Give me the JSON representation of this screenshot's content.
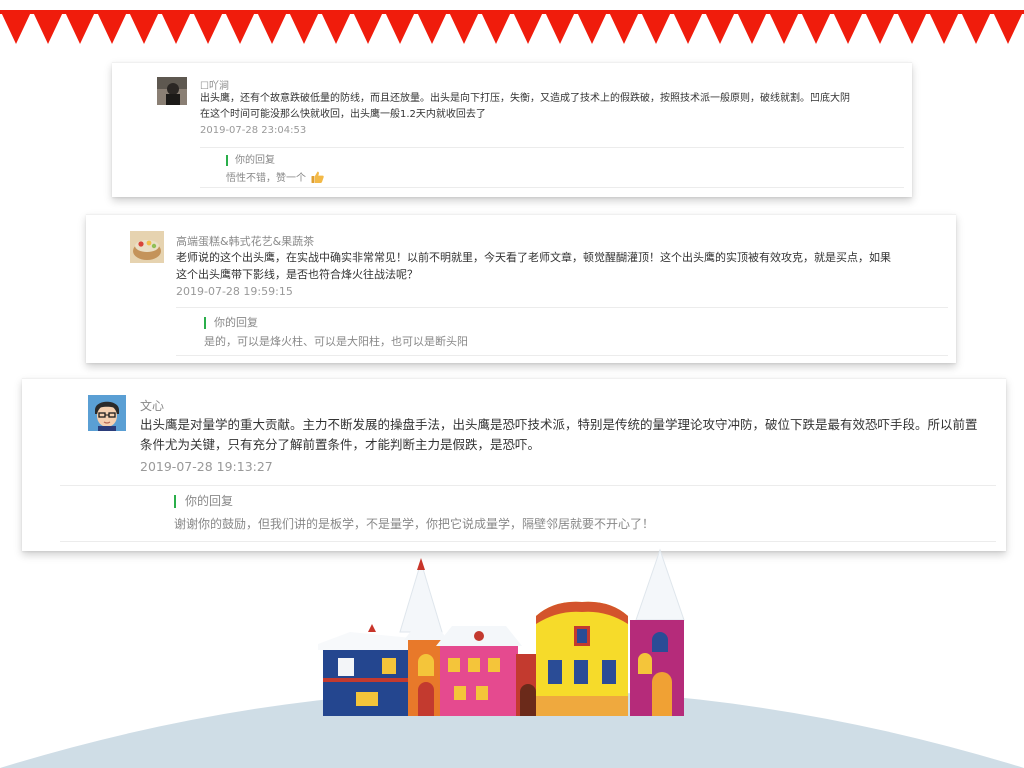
{
  "comments": [
    {
      "author": "☐吖涧",
      "text": "出头鹰，还有个故意跌破低量的防线，而且还放量。出头是向下打压，失衡，又造成了技术上的假跌破，按照技术派一般原则，破线就割。凹底大阴在这个时间可能没那么快就收回，出头鹰一般1.2天内就收回去了",
      "date": "2019-07-28 23:04:53",
      "reply_label": "你的回复",
      "reply_text": "悟性不错，赞一个",
      "reply_icon": "thumbs-up-icon"
    },
    {
      "author": "高端蛋糕&韩式花艺&果蔬茶",
      "text": "老师说的这个出头鹰，在实战中确实非常常见！以前不明就里，今天看了老师文章，顿觉醒醐灌顶！这个出头鹰的实顶被有效攻克，就是买点，如果这个出头鹰带下影线，是否也符合烽火往战法呢？",
      "date": "2019-07-28 19:59:15",
      "reply_label": "你的回复",
      "reply_text": "是的，可以是烽火柱、可以是大阳柱，也可以是断头阳"
    },
    {
      "author": "文心",
      "text": "出头鹰是对量学的重大贡献。主力不断发展的操盘手法，出头鹰是恐吓技术派，特别是传统的量学理论攻守冲防，破位下跌是最有效恐吓手段。所以前置条件尤为关键，只有充分了解前置条件，才能判断主力是假跌，是恐吓。",
      "date": "2019-07-28 19:13:27",
      "reply_label": "你的回复",
      "reply_text": "谢谢你的鼓励，但我们讲的是板学，不是量学，你把它说成量学，隔壁邻居就要不开心了！"
    }
  ],
  "colors": {
    "bunting": "#f01c0c",
    "reply_bar": "#2aae4a",
    "hill": "#cfdde6"
  }
}
